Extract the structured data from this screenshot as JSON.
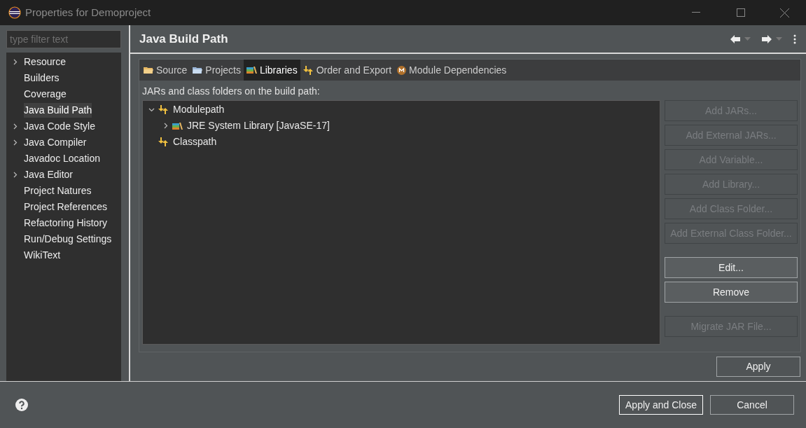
{
  "window": {
    "title": "Properties for Demoproject"
  },
  "filter": {
    "placeholder": "type filter text"
  },
  "sidebar": {
    "items": [
      {
        "label": "Resource",
        "expandable": true,
        "selected": false
      },
      {
        "label": "Builders",
        "expandable": false,
        "selected": false
      },
      {
        "label": "Coverage",
        "expandable": false,
        "selected": false
      },
      {
        "label": "Java Build Path",
        "expandable": false,
        "selected": true
      },
      {
        "label": "Java Code Style",
        "expandable": true,
        "selected": false
      },
      {
        "label": "Java Compiler",
        "expandable": true,
        "selected": false
      },
      {
        "label": "Javadoc Location",
        "expandable": false,
        "selected": false
      },
      {
        "label": "Java Editor",
        "expandable": true,
        "selected": false
      },
      {
        "label": "Project Natures",
        "expandable": false,
        "selected": false
      },
      {
        "label": "Project References",
        "expandable": false,
        "selected": false
      },
      {
        "label": "Refactoring History",
        "expandable": false,
        "selected": false
      },
      {
        "label": "Run/Debug Settings",
        "expandable": false,
        "selected": false
      },
      {
        "label": "WikiText",
        "expandable": false,
        "selected": false
      }
    ]
  },
  "page": {
    "title": "Java Build Path"
  },
  "tabs": [
    {
      "label": "Source",
      "kind": "source",
      "selected": false
    },
    {
      "label": "Projects",
      "kind": "projects",
      "selected": false
    },
    {
      "label": "Libraries",
      "kind": "library",
      "selected": true
    },
    {
      "label": "Order and Export",
      "kind": "order",
      "selected": false
    },
    {
      "label": "Module Dependencies",
      "kind": "module",
      "selected": false
    }
  ],
  "tree": {
    "caption": "JARs and class folders on the build path:",
    "items": [
      {
        "label": "Modulepath",
        "kind": "container",
        "expanded": true,
        "children": [
          {
            "label": "JRE System Library [JavaSE-17]",
            "kind": "library",
            "expanded": false
          }
        ]
      },
      {
        "label": "Classpath",
        "kind": "container"
      }
    ]
  },
  "button_groups": [
    [
      {
        "label": "Add JARs...",
        "disabled": true
      },
      {
        "label": "Add External JARs...",
        "disabled": true
      },
      {
        "label": "Add Variable...",
        "disabled": true
      },
      {
        "label": "Add Library...",
        "disabled": true
      },
      {
        "label": "Add Class Folder...",
        "disabled": true
      },
      {
        "label": "Add External Class Folder...",
        "disabled": true
      }
    ],
    [
      {
        "label": "Edit...",
        "disabled": false
      },
      {
        "label": "Remove",
        "disabled": false
      }
    ],
    [
      {
        "label": "Migrate JAR File...",
        "disabled": true
      }
    ]
  ],
  "apply": {
    "label": "Apply"
  },
  "footer": {
    "buttons": [
      {
        "label": "Apply and Close",
        "default": true
      },
      {
        "label": "Cancel",
        "default": false
      }
    ]
  }
}
